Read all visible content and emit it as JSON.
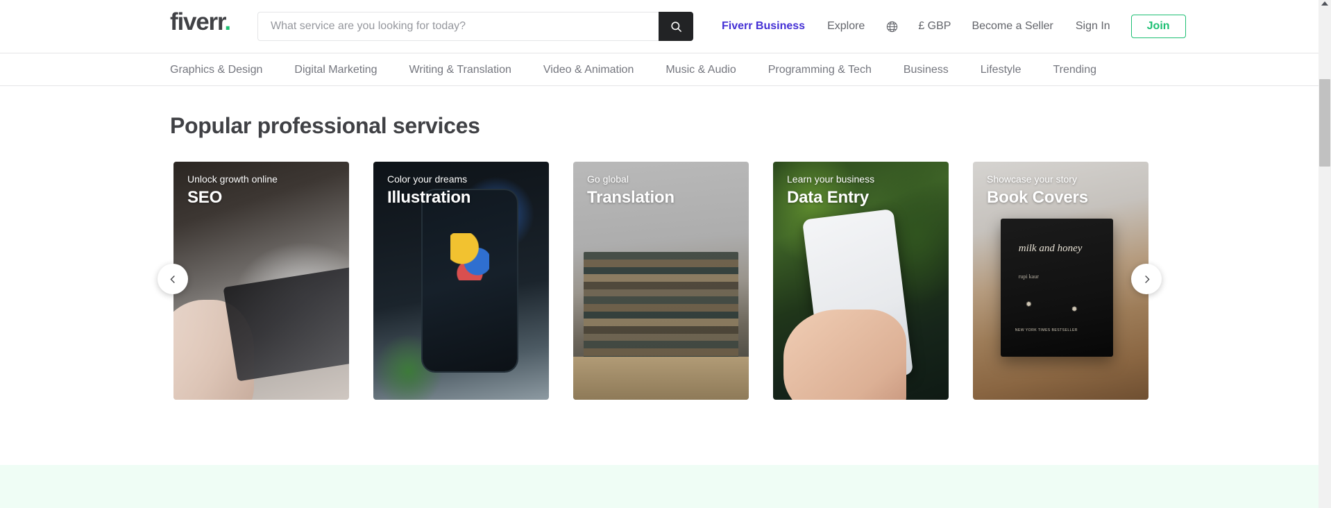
{
  "header": {
    "logo_text": "fiverr",
    "logo_dot": ".",
    "search": {
      "placeholder": "What service are you looking for today?",
      "value": "",
      "search_icon": "search-icon"
    },
    "nav": [
      {
        "label": "Fiverr Business",
        "style": "business"
      },
      {
        "label": "Explore",
        "style": "plain"
      }
    ],
    "globe_icon": "globe-icon",
    "currency": "£ GBP",
    "become_seller": "Become a Seller",
    "sign_in": "Sign In",
    "join": "Join",
    "join_color": "#1dbf73",
    "business_color": "#4430d5"
  },
  "categories": [
    "Graphics & Design",
    "Digital Marketing",
    "Writing & Translation",
    "Video & Animation",
    "Music & Audio",
    "Programming & Tech",
    "Business",
    "Lifestyle",
    "Trending"
  ],
  "main": {
    "section_title": "Popular professional services",
    "cards": [
      {
        "subtitle": "Unlock growth online",
        "title": "SEO",
        "bg": "bg-seo"
      },
      {
        "subtitle": "Color your dreams",
        "title": "Illustration",
        "bg": "bg-illustration"
      },
      {
        "subtitle": "Go global",
        "title": "Translation",
        "bg": "bg-translation"
      },
      {
        "subtitle": "Learn your business",
        "title": "Data Entry",
        "bg": "bg-dataentry"
      },
      {
        "subtitle": "Showcase your story",
        "title": "Book Covers",
        "bg": "bg-bookcovers"
      }
    ],
    "prev_arrow_icon": "chevron-left-icon",
    "next_arrow_icon": "chevron-right-icon",
    "book_cover_art": {
      "title": "milk and honey",
      "author": "rupi kaur",
      "badge": "NEW YORK TIMES BESTSELLER"
    }
  },
  "colors": {
    "accent_green": "#1dbf73",
    "band_green": "#effdf5",
    "text_dark": "#404145",
    "text_muted": "#74767e"
  }
}
